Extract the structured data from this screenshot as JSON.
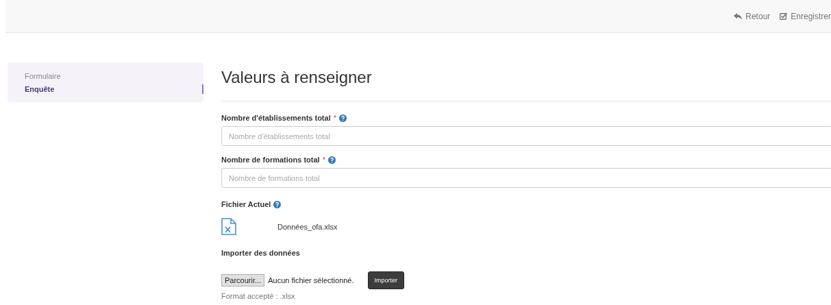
{
  "toolbar": {
    "buttons": [
      {
        "kind": "back",
        "label": "Retour"
      },
      {
        "kind": "save",
        "label": "Enregistrer"
      }
    ]
  },
  "sidebar": {
    "items": [
      {
        "label": "Formulaire",
        "selected": false
      },
      {
        "label": "Enquête",
        "selected": true
      }
    ]
  },
  "main": {
    "title": "Valeurs à renseigner",
    "fields": [
      {
        "label": "Nombre d'établissements total",
        "required": "*",
        "help": true,
        "placeholder": "Nombre d'établissements total"
      },
      {
        "label": "Nombre de formations total",
        "required": "*",
        "help": true,
        "placeholder": "Nombre de formations total"
      }
    ],
    "current_file": {
      "label": "Fichier Actuel",
      "help": true,
      "file_name": "Données_ofa.xlsx"
    },
    "import": {
      "label": "Importer des données",
      "browse_button": "Parcourir...",
      "file_status": "Aucun fichier sélectionné.",
      "import_button": "Importer",
      "hint": "Format accepté : .xlsx"
    }
  }
}
